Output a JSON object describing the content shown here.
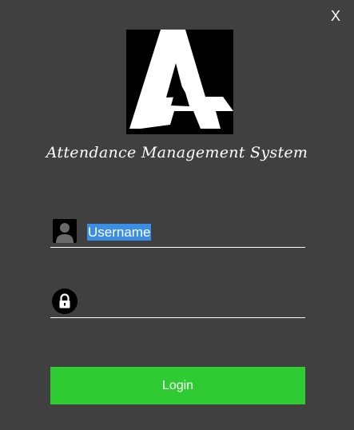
{
  "window": {
    "close_label": "X",
    "background_color": "#404040"
  },
  "logo": {
    "icon": "a-plus-logo-icon"
  },
  "header": {
    "title": "Attendance Management System"
  },
  "form": {
    "username": {
      "icon": "user-icon",
      "value": "Username",
      "selected": true
    },
    "password": {
      "icon": "lock-icon",
      "value": ""
    },
    "login_label": "Login",
    "login_color": "#2ecc32",
    "selection_color": "#3a8ee6"
  }
}
